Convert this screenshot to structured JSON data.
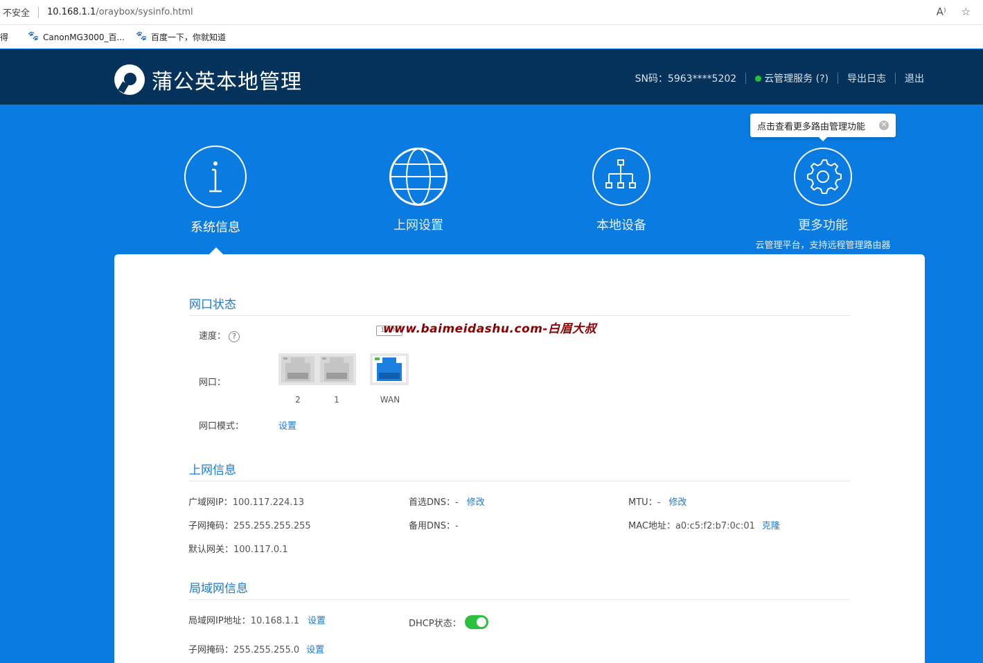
{
  "browser": {
    "insecure_label": "不安全",
    "url_host": "10.168.1.1",
    "url_path": "/oraybox/sysinfo.html",
    "read_aloud_icon": "A⁾",
    "star_icon": "☆",
    "bookmarks": [
      {
        "label": "得"
      },
      {
        "label": "CanonMG3000_百..."
      },
      {
        "label": "百度一下，你就知道"
      }
    ]
  },
  "header": {
    "title": "蒲公英本地管理",
    "sn": "SN码：5963****5202",
    "cloud_service": "云管理服务 (?)",
    "export_log": "导出日志",
    "logout": "退出"
  },
  "tooltip": {
    "text": "点击查看更多路由管理功能"
  },
  "nav": [
    {
      "label": "系统信息",
      "icon": "info-icon"
    },
    {
      "label": "上网设置",
      "icon": "globe-icon"
    },
    {
      "label": "本地设备",
      "icon": "network-tree-icon"
    },
    {
      "label": "更多功能",
      "icon": "gear-icon",
      "sub": "云管理平台，支持远程管理路由器"
    }
  ],
  "port_status": {
    "title": "网口状态",
    "speed_label": "速度：",
    "speed_help": "?",
    "badge": "100M",
    "ports_label": "网口：",
    "ports": [
      {
        "label": "2"
      },
      {
        "label": "1"
      },
      {
        "label": "WAN"
      }
    ],
    "mode_label": "网口模式：",
    "mode_link": "设置",
    "watermark": "www.baimeidashu.com-白眉大叔"
  },
  "internet_info": {
    "title": "上网信息",
    "wan_ip_label": "广域网IP：",
    "wan_ip": "100.117.224.13",
    "mask_label": "子网掩码：",
    "mask": "255.255.255.255",
    "gateway_label": "默认网关：",
    "gateway": "100.117.0.1",
    "dns1_label": "首选DNS：",
    "dns1": "-",
    "dns1_link": "修改",
    "dns2_label": "备用DNS：",
    "dns2": "-",
    "mtu_label": "MTU：",
    "mtu": "-",
    "mtu_link": "修改",
    "mac_label": "MAC地址：",
    "mac": "a0:c5:f2:b7:0c:01",
    "mac_link": "克隆"
  },
  "lan_info": {
    "title": "局域网信息",
    "ip_label": "局域网IP地址：",
    "ip": "10.168.1.1",
    "ip_link": "设置",
    "mask_label": "子网掩码：",
    "mask": "255.255.255.0",
    "mask_link": "设置",
    "dhcp_label": "DHCP状态：",
    "dhcp_enabled": true
  }
}
